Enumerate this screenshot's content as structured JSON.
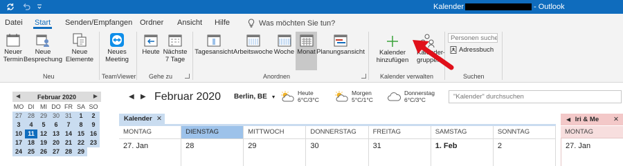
{
  "window": {
    "title": "Kalender - ",
    "title_suffix": "- Outlook",
    "accent": "#0f6cbd"
  },
  "tabs": [
    {
      "label": "Datei"
    },
    {
      "label": "Start"
    },
    {
      "label": "Senden/Empfangen"
    },
    {
      "label": "Ordner"
    },
    {
      "label": "Ansicht"
    },
    {
      "label": "Hilfe"
    }
  ],
  "tellme": {
    "label": "Was möchten Sie tun?",
    "icon": "lightbulb-icon"
  },
  "ribbon": {
    "neu": {
      "label": "Neu",
      "new_appointment": "Neuer Termin",
      "new_meeting": "Neue Besprechung",
      "new_items": "Neue Elemente"
    },
    "teamviewer": {
      "label": "TeamViewer",
      "new_meeting": "Neues Meeting"
    },
    "gehe_zu": {
      "label": "Gehe zu",
      "today": "Heute",
      "next7": "Nächste 7 Tage"
    },
    "anordnen": {
      "label": "Anordnen",
      "day": "Tagesansicht",
      "workweek": "Arbeitswoche",
      "week": "Woche",
      "month": "Monat",
      "schedule": "Planungsansicht"
    },
    "kalender_verwalten": {
      "label": "Kalender verwalten",
      "add_calendar": "Kalender hinzufügen",
      "groups": "Kalender­gruppen"
    },
    "suchen": {
      "label": "Suchen",
      "people_search": "Personen suchen",
      "address_book": "Adressbuch"
    }
  },
  "mini_calendar": {
    "title": "Februar 2020",
    "weekdays": [
      "MO",
      "DI",
      "MI",
      "DO",
      "FR",
      "SA",
      "SO"
    ],
    "weeks": [
      [
        {
          "d": "27",
          "o": true
        },
        {
          "d": "28",
          "o": true
        },
        {
          "d": "29",
          "o": true
        },
        {
          "d": "30",
          "o": true
        },
        {
          "d": "31",
          "o": true
        },
        {
          "d": "1"
        },
        {
          "d": "2"
        }
      ],
      [
        {
          "d": "3"
        },
        {
          "d": "4"
        },
        {
          "d": "5"
        },
        {
          "d": "6"
        },
        {
          "d": "7"
        },
        {
          "d": "8"
        },
        {
          "d": "9"
        }
      ],
      [
        {
          "d": "10"
        },
        {
          "d": "11",
          "today": true
        },
        {
          "d": "12"
        },
        {
          "d": "13"
        },
        {
          "d": "14"
        },
        {
          "d": "15"
        },
        {
          "d": "16"
        }
      ],
      [
        {
          "d": "17"
        },
        {
          "d": "18"
        },
        {
          "d": "19"
        },
        {
          "d": "20"
        },
        {
          "d": "21"
        },
        {
          "d": "22"
        },
        {
          "d": "23"
        }
      ],
      [
        {
          "d": "24"
        },
        {
          "d": "25"
        },
        {
          "d": "26"
        },
        {
          "d": "27"
        },
        {
          "d": "28"
        },
        {
          "d": "29"
        },
        {
          "d": "",
          "blank": true
        }
      ]
    ]
  },
  "nav": {
    "month_title": "Februar 2020",
    "location": "Berlin, BE",
    "weather": [
      {
        "day": "Heute",
        "temp": "6°C/3°C",
        "icon": "partly-cloudy-icon"
      },
      {
        "day": "Morgen",
        "temp": "5°C/1°C",
        "icon": "partly-cloudy-icon"
      },
      {
        "day": "Donnerstag",
        "temp": "6°C/3°C",
        "icon": "cloud-icon"
      }
    ],
    "search_placeholder": "\"Kalender\" durchsuchen"
  },
  "calendar": {
    "tab_label": "Kalender",
    "day_headers": [
      "MONTAG",
      "DIENSTAG",
      "MITTWOCH",
      "DONNERSTAG",
      "FREITAG",
      "SAMSTAG",
      "SONNTAG"
    ],
    "selected_header": 1,
    "day_numbers": [
      "27. Jan",
      "28",
      "29",
      "30",
      "31",
      "1. Feb",
      "2"
    ]
  },
  "calendar2": {
    "tab_label": "Iri & Me",
    "day_header": "MONTAG",
    "day_number": "27. Jan"
  },
  "annotation": {
    "arrow_color": "#e0101a"
  }
}
